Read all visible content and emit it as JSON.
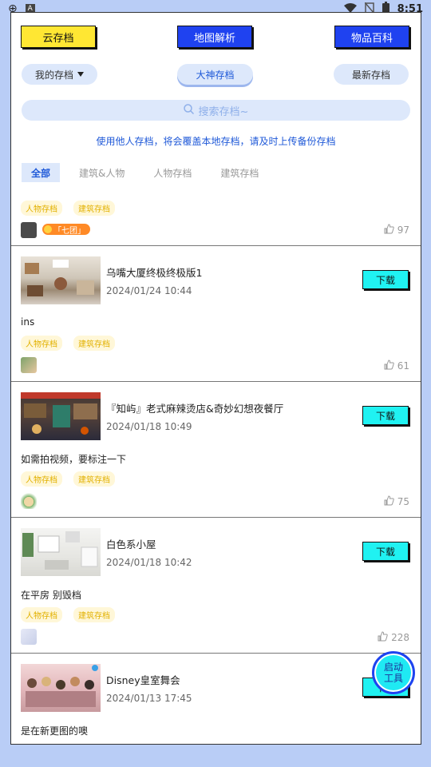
{
  "status_bar": {
    "time": "8:51"
  },
  "top_buttons": {
    "cloud": "云存档",
    "map": "地图解析",
    "items": "物品百科"
  },
  "filters": {
    "mine": "我的存档",
    "master": "大神存档",
    "latest": "最新存档"
  },
  "search": {
    "placeholder": "搜索存档~"
  },
  "notice": "使用他人存档，将会覆盖本地存档，请及时上传备份存档",
  "tabs": [
    "全部",
    "建筑&人物",
    "人物存档",
    "建筑存档"
  ],
  "partial_item": {
    "tags": [
      "人物存档",
      "建筑存档"
    ],
    "group": "「七团」",
    "likes": "97"
  },
  "download_label": "下载",
  "items": [
    {
      "title": "乌嘴大厦终极终极版1",
      "date": "2024/01/24 10:44",
      "desc": "ins",
      "tags": [
        "人物存档",
        "建筑存档"
      ],
      "likes": "61"
    },
    {
      "title": "『知屿』老式麻辣烫店&奇妙幻想夜餐厅",
      "date": "2024/01/18 10:49",
      "desc": "如需拍视频，要标注一下",
      "tags": [
        "人物存档",
        "建筑存档"
      ],
      "likes": "75"
    },
    {
      "title": "白色系小屋",
      "date": "2024/01/18 10:42",
      "desc": "在平房 别毁档",
      "tags": [
        "人物存档",
        "建筑存档"
      ],
      "likes": "228"
    },
    {
      "title": "Disney皇室舞会",
      "date": "2024/01/13 17:45",
      "desc": "是在新更图的噢"
    }
  ],
  "fab": {
    "line1": "启动",
    "line2": "工具"
  }
}
